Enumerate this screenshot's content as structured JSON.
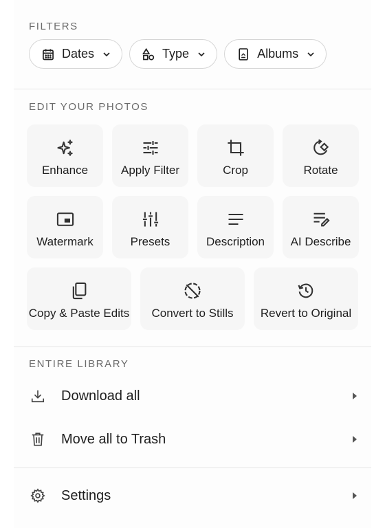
{
  "filters": {
    "label": "FILTERS",
    "chips": [
      {
        "label": "Dates",
        "icon": "calendar-icon"
      },
      {
        "label": "Type",
        "icon": "shapes-icon"
      },
      {
        "label": "Albums",
        "icon": "album-icon"
      }
    ]
  },
  "edit": {
    "label": "EDIT YOUR PHOTOS",
    "tiles": [
      {
        "label": "Enhance",
        "icon": "sparkle-icon"
      },
      {
        "label": "Apply Filter",
        "icon": "tune-icon"
      },
      {
        "label": "Crop",
        "icon": "crop-icon"
      },
      {
        "label": "Rotate",
        "icon": "rotate-icon"
      },
      {
        "label": "Watermark",
        "icon": "watermark-icon"
      },
      {
        "label": "Presets",
        "icon": "sliders-icon"
      },
      {
        "label": "Description",
        "icon": "description-icon"
      },
      {
        "label": "AI Describe",
        "icon": "edit-note-icon"
      },
      {
        "label": "Copy & Paste Edits",
        "icon": "copy-icon"
      },
      {
        "label": "Convert to Stills",
        "icon": "no-motion-icon"
      },
      {
        "label": "Revert to Original",
        "icon": "history-icon"
      }
    ]
  },
  "library": {
    "label": "ENTIRE LIBRARY",
    "items": [
      {
        "label": "Download all",
        "icon": "download-icon"
      },
      {
        "label": "Move all to Trash",
        "icon": "trash-icon"
      }
    ]
  },
  "settings": {
    "label": "Settings",
    "icon": "gear-icon"
  },
  "colors": {
    "text": "#1f1f1f",
    "secondary": "#6b6b6b",
    "tile_bg": "#f6f6f6",
    "divider": "#e6e6e6"
  }
}
